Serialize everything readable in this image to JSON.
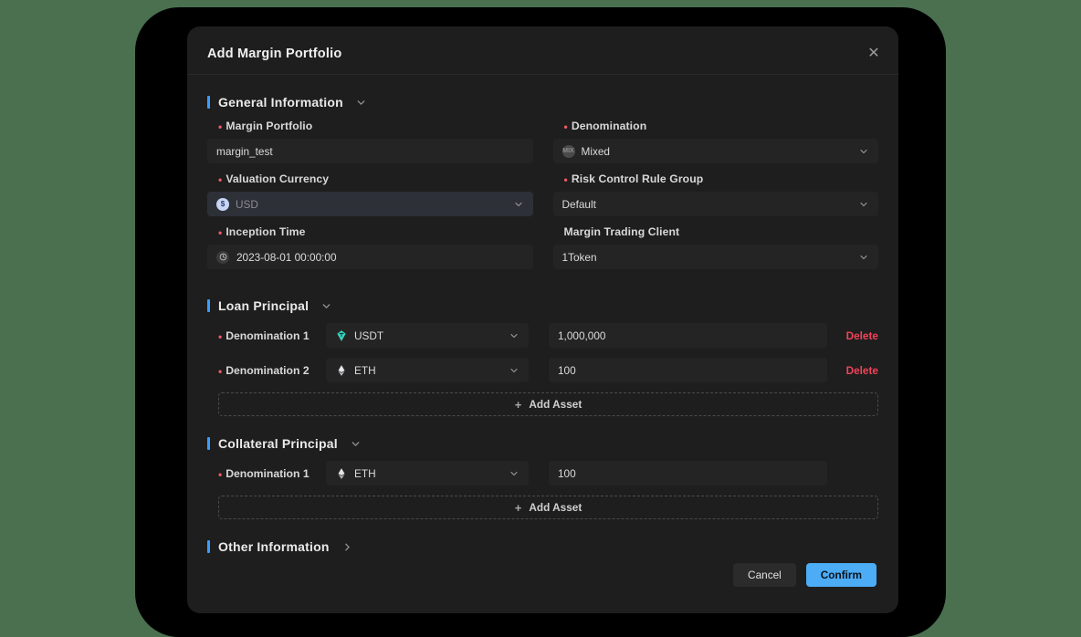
{
  "modal": {
    "title": "Add Margin Portfolio",
    "close_icon": "close-icon"
  },
  "accent": {
    "section_bar": "#3b9dff",
    "required": "#f05a64",
    "delete": "#f0435a",
    "confirm": "#4cacf5",
    "usdt": "#3ad4c0",
    "eth": "#e6e6ea"
  },
  "sections": {
    "general": {
      "title": "General Information",
      "expanded": true,
      "fields": {
        "margin_portfolio": {
          "label": "Margin Portfolio",
          "required": true,
          "value": "margin_test",
          "placeholder": "Margin Portfolio"
        },
        "denomination": {
          "label": "Denomination",
          "required": true,
          "value": "Mixed",
          "icon": "mixed-coin-icon"
        },
        "valuation_currency": {
          "label": "Valuation Currency",
          "required": true,
          "value": "USD",
          "icon": "usd-coin-icon",
          "disabled": true
        },
        "risk_control_rule_group": {
          "label": "Risk Control Rule Group",
          "required": true,
          "value": "Default"
        },
        "inception_time": {
          "label": "Inception Time",
          "required": true,
          "value": "2023-08-01 00:00:00",
          "icon": "clock-icon"
        },
        "margin_trading_client": {
          "label": "Margin Trading Client",
          "required": false,
          "value": "1Token"
        }
      }
    },
    "loan_principal": {
      "title": "Loan Principal",
      "expanded": true,
      "add_asset_label": "Add Asset",
      "rows": [
        {
          "label": "Denomination 1",
          "required": true,
          "asset": "USDT",
          "asset_icon": "usdt-gem-icon",
          "amount": "1,000,000",
          "delete_label": "Delete",
          "deletable": true
        },
        {
          "label": "Denomination 2",
          "required": true,
          "asset": "ETH",
          "asset_icon": "eth-gem-icon",
          "amount": "100",
          "delete_label": "Delete",
          "deletable": true
        }
      ]
    },
    "collateral_principal": {
      "title": "Collateral Principal",
      "expanded": true,
      "add_asset_label": "Add Asset",
      "rows": [
        {
          "label": "Denomination 1",
          "required": true,
          "asset": "ETH",
          "asset_icon": "eth-gem-icon",
          "amount": "100",
          "delete_label": "",
          "deletable": false
        }
      ]
    },
    "other": {
      "title": "Other Information",
      "expanded": false
    }
  },
  "footer": {
    "cancel_label": "Cancel",
    "confirm_label": "Confirm"
  }
}
